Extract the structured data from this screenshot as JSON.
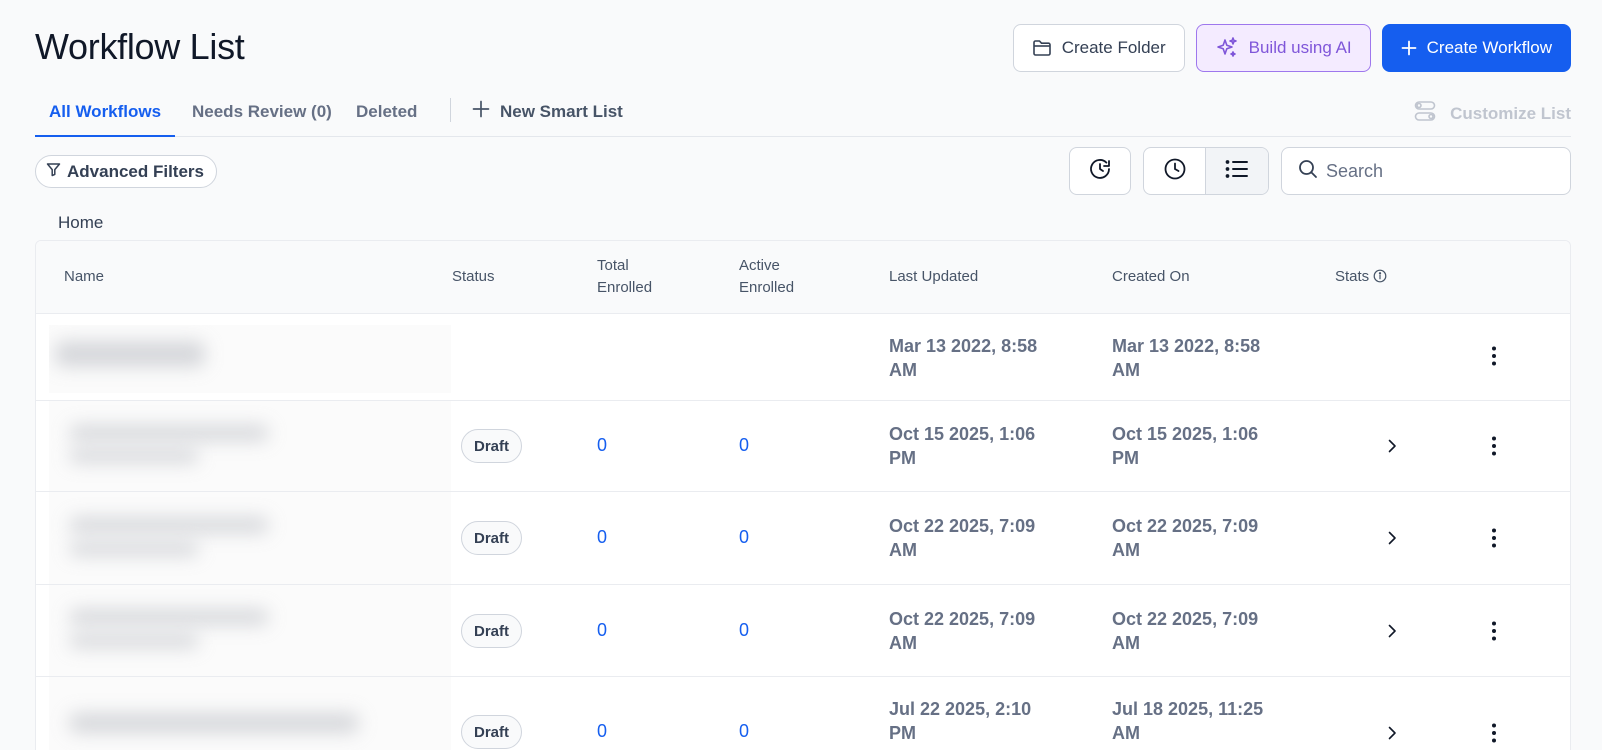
{
  "page": {
    "title": "Workflow List"
  },
  "actions": {
    "create_folder": "Create Folder",
    "build_ai": "Build using AI",
    "create_workflow": "Create Workflow"
  },
  "tabs": {
    "all": "All Workflows",
    "needs_review": "Needs Review (0)",
    "deleted": "Deleted",
    "new_smart_list": "New Smart List",
    "customize": "Customize List"
  },
  "filters": {
    "advanced": "Advanced Filters"
  },
  "search": {
    "placeholder": "Search"
  },
  "breadcrumb": "Home",
  "table": {
    "headers": {
      "name": "Name",
      "status": "Status",
      "total_l1": "Total",
      "total_l2": "Enrolled",
      "active_l1": "Active",
      "active_l2": "Enrolled",
      "last_updated": "Last Updated",
      "created_on": "Created On",
      "stats": "Stats"
    },
    "rows": [
      {
        "status": "",
        "total": "",
        "active": "",
        "updated_l1": "Mar 13 2022, 8:58",
        "updated_l2": "AM",
        "created_l1": "Mar 13 2022, 8:58",
        "created_l2": "AM"
      },
      {
        "status": "Draft",
        "total": "0",
        "active": "0",
        "updated_l1": "Oct 15 2025, 1:06",
        "updated_l2": "PM",
        "created_l1": "Oct 15 2025, 1:06",
        "created_l2": "PM"
      },
      {
        "status": "Draft",
        "total": "0",
        "active": "0",
        "updated_l1": "Oct 22 2025, 7:09",
        "updated_l2": "AM",
        "created_l1": "Oct 22 2025, 7:09",
        "created_l2": "AM"
      },
      {
        "status": "Draft",
        "total": "0",
        "active": "0",
        "updated_l1": "Oct 22 2025, 7:09",
        "updated_l2": "AM",
        "created_l1": "Oct 22 2025, 7:09",
        "created_l2": "AM"
      },
      {
        "status": "Draft",
        "total": "0",
        "active": "0",
        "updated_l1": "Jul 22 2025, 2:10",
        "updated_l2": "PM",
        "created_l1": "Jul 18 2025, 11:25",
        "created_l2": "AM"
      }
    ]
  },
  "colors": {
    "primary": "#155eef",
    "ai": "#7f56d9",
    "ai_bg": "#f4ebff",
    "text": "#101828",
    "muted": "#667085"
  }
}
